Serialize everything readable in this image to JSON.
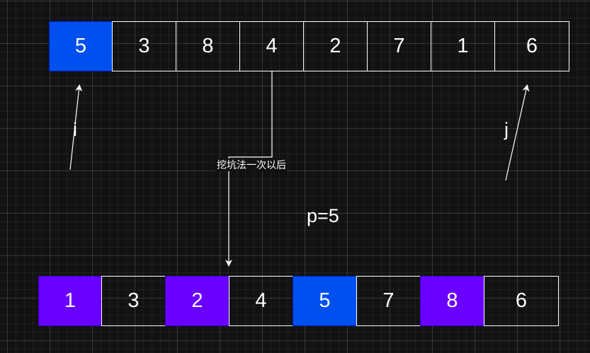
{
  "top_array": {
    "cells": [
      {
        "value": "5",
        "state": "pivot"
      },
      {
        "value": "3",
        "state": "plain"
      },
      {
        "value": "8",
        "state": "plain"
      },
      {
        "value": "4",
        "state": "plain"
      },
      {
        "value": "2",
        "state": "plain"
      },
      {
        "value": "7",
        "state": "plain"
      },
      {
        "value": "1",
        "state": "plain"
      },
      {
        "value": "6",
        "state": "plain"
      }
    ]
  },
  "bottom_array": {
    "cells": [
      {
        "value": "1",
        "state": "moved"
      },
      {
        "value": "3",
        "state": "plain"
      },
      {
        "value": "2",
        "state": "moved"
      },
      {
        "value": "4",
        "state": "plain"
      },
      {
        "value": "5",
        "state": "pivot"
      },
      {
        "value": "7",
        "state": "plain"
      },
      {
        "value": "8",
        "state": "moved"
      },
      {
        "value": "6",
        "state": "plain"
      }
    ]
  },
  "pointers": {
    "i": "i",
    "j": "j"
  },
  "step_note": "挖坑法一次以后",
  "pivot_label": "p=5",
  "colors": {
    "background": "#121212",
    "pivot": "#0050ef",
    "moved": "#6a00ff",
    "stroke": "#ffffff"
  }
}
